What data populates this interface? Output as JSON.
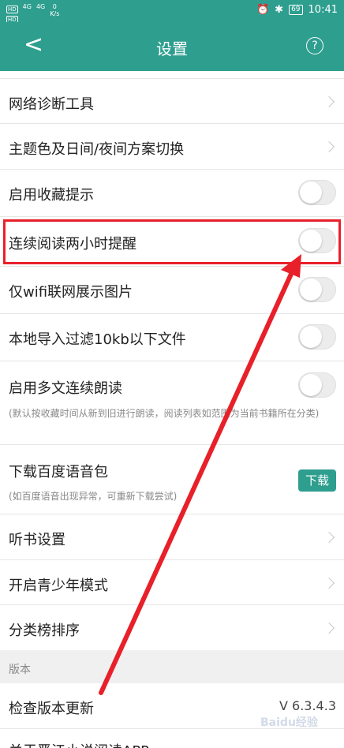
{
  "status": {
    "hd1": "HD",
    "hd2": "HD",
    "sig1": "4G",
    "sig2": "4G",
    "speed_value": "0",
    "speed_unit": "K/s",
    "battery": "69",
    "time": "10:41"
  },
  "header": {
    "title": "设置",
    "back_icon": "chevron-left-icon",
    "help_icon": "question-circle-icon",
    "help_glyph": "?"
  },
  "rows": {
    "network": {
      "label": "网络诊断工具"
    },
    "theme": {
      "label": "主题色及日间/夜间方案切换"
    },
    "fav_tip": {
      "label": "启用收藏提示",
      "state": "off"
    },
    "reading_reminder": {
      "label": "连续阅读两小时提醒",
      "state": "off"
    },
    "wifi_images": {
      "label": "仅wifi联网展示图片",
      "state": "off"
    },
    "filter_10kb": {
      "label": "本地导入过滤10kb以下文件",
      "state": "off"
    },
    "multi_read": {
      "label": "启用多文连续朗读",
      "state": "off",
      "sub": "(默认按收藏时间从新到旧进行朗读，阅读列表如范围为当前书籍所在分类)"
    },
    "baidu_voice": {
      "label": "下载百度语音包",
      "button": "下载",
      "sub": "(如百度语音出现异常，可重新下载尝试)"
    },
    "listen": {
      "label": "听书设置"
    },
    "youth": {
      "label": "开启青少年模式"
    },
    "rank": {
      "label": "分类榜排序"
    },
    "check_update": {
      "label": "检查版本更新",
      "value": "V 6.3.4.3"
    },
    "about": {
      "label": "关于晋江小说阅读APP"
    }
  },
  "sections": {
    "version": "版本"
  },
  "watermark": "Baidu经验",
  "colors": {
    "accent": "#2e9e8f",
    "annotation": "#e8202a"
  }
}
